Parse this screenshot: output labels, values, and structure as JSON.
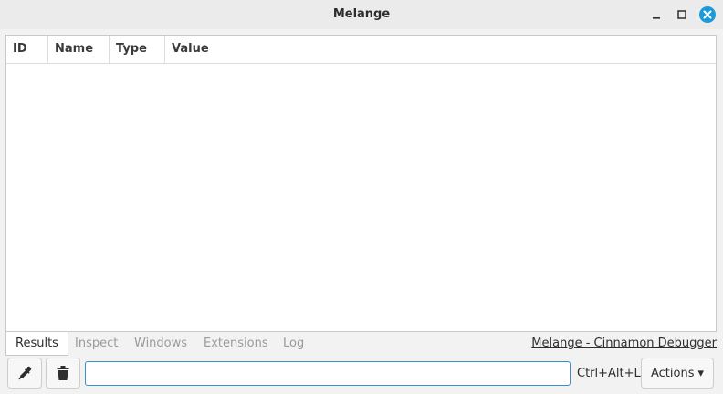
{
  "window": {
    "title": "Melange"
  },
  "table": {
    "columns": [
      "ID",
      "Name",
      "Type",
      "Value"
    ],
    "rows": []
  },
  "tabs": [
    {
      "label": "Results",
      "active": true
    },
    {
      "label": "Inspect",
      "active": false
    },
    {
      "label": "Windows",
      "active": false
    },
    {
      "label": "Extensions",
      "active": false
    },
    {
      "label": "Log",
      "active": false
    }
  ],
  "debugger_link": "Melange - Cinnamon Debugger",
  "toolbar": {
    "picker_icon": "eyedropper-icon",
    "trash_icon": "trash-icon",
    "command_value": "",
    "shortcut": "Ctrl+Alt+L",
    "actions_label": "Actions",
    "actions_arrow": "▾"
  },
  "colors": {
    "accent": "#3b8fc8",
    "close_button": "#1a9bd7"
  }
}
